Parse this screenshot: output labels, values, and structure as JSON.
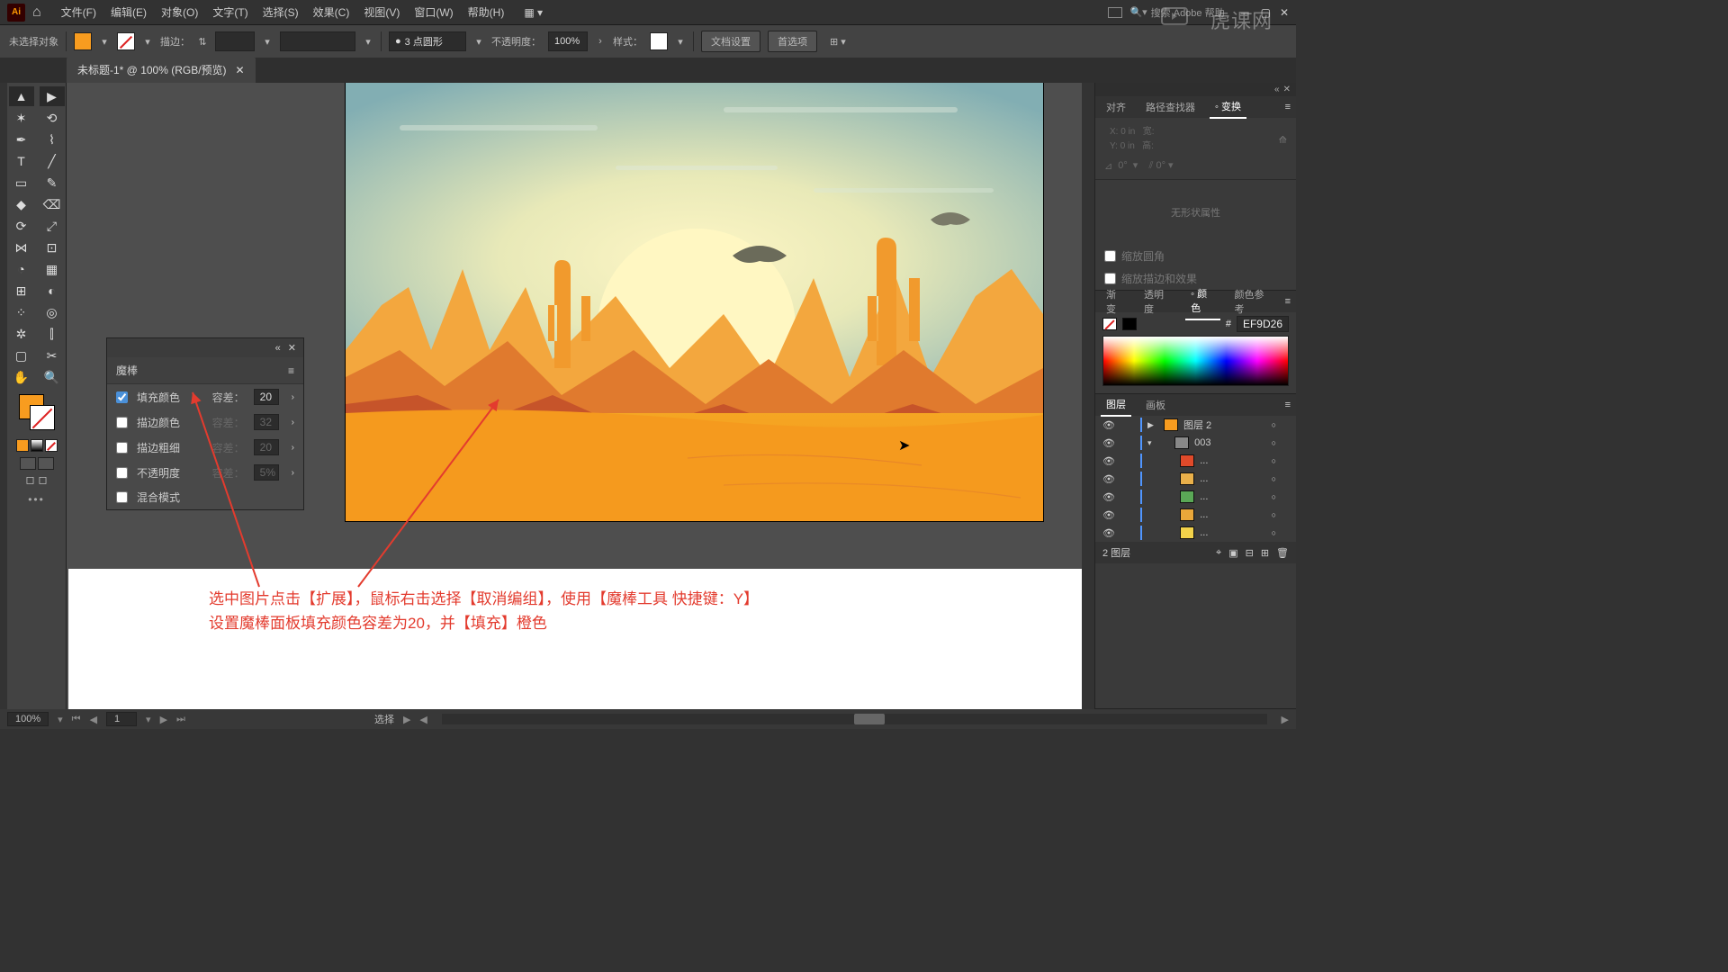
{
  "menubar": {
    "logo": "Ai",
    "items": [
      "文件(F)",
      "编辑(E)",
      "对象(O)",
      "文字(T)",
      "选择(S)",
      "效果(C)",
      "视图(V)",
      "窗口(W)",
      "帮助(H)"
    ],
    "search_placeholder": "搜索 Adobe 帮助"
  },
  "controlbar": {
    "no_selection": "未选择对象",
    "stroke_label": "描边：",
    "stroke_style": "3 点圆形",
    "opacity_label": "不透明度：",
    "opacity_value": "100%",
    "style_label": "样式：",
    "doc_setup": "文档设置",
    "prefs": "首选项"
  },
  "doctab": {
    "title": "未标题-1* @ 100% (RGB/预览)"
  },
  "wand_panel": {
    "title": "魔棒",
    "rows": {
      "fill": {
        "label": "填充颜色",
        "checked": true
      },
      "stroke_color": {
        "label": "描边颜色",
        "checked": false,
        "tol": "32"
      },
      "stroke_weight": {
        "label": "描边粗细",
        "checked": false,
        "tol": "20"
      },
      "opacity": {
        "label": "不透明度",
        "checked": false,
        "tol": "5%"
      },
      "blend": {
        "label": "混合模式",
        "checked": false
      }
    },
    "tolerance_label": "容差：",
    "tolerance_value": "20"
  },
  "caption": {
    "line1": "选中图片点击【扩展】，鼠标右击选择【取消编组】，使用【魔棒工具 快捷键：Y】",
    "line2": "设置魔棒面板填充颜色容差为20，并【填充】橙色"
  },
  "right": {
    "align_tabs": [
      "对齐",
      "路径查找器",
      "变换"
    ],
    "transform": {
      "x": "0 in",
      "y": "0 in",
      "w": "",
      "h": "",
      "angle": "0°"
    },
    "no_shape": "无形状属性",
    "round_label": "缩放圆角",
    "scale_stroke": "缩放描边和效果",
    "color_tabs": [
      "渐变",
      "透明度",
      "颜色",
      "颜色参考"
    ],
    "hex_label": "#",
    "hex_value": "EF9D26",
    "layers_tabs": [
      "图层",
      "画板"
    ],
    "layers": [
      {
        "name": "图层 2",
        "color": "#f89c1f",
        "top": true,
        "disclosure": "▶"
      },
      {
        "name": "003",
        "color": "#888",
        "disclosure": "▾"
      },
      {
        "name": "...",
        "color": "#e04a2a"
      },
      {
        "name": "...",
        "color": "#e9b04a"
      },
      {
        "name": "...",
        "color": "#5aa856"
      },
      {
        "name": "...",
        "color": "#e9a73a"
      },
      {
        "name": "...",
        "color": "#f2d24a"
      }
    ],
    "layers_count": "2 图层"
  },
  "statusbar": {
    "zoom": "100%",
    "page": "1",
    "mode": "选择"
  },
  "watermark": "虎课网"
}
